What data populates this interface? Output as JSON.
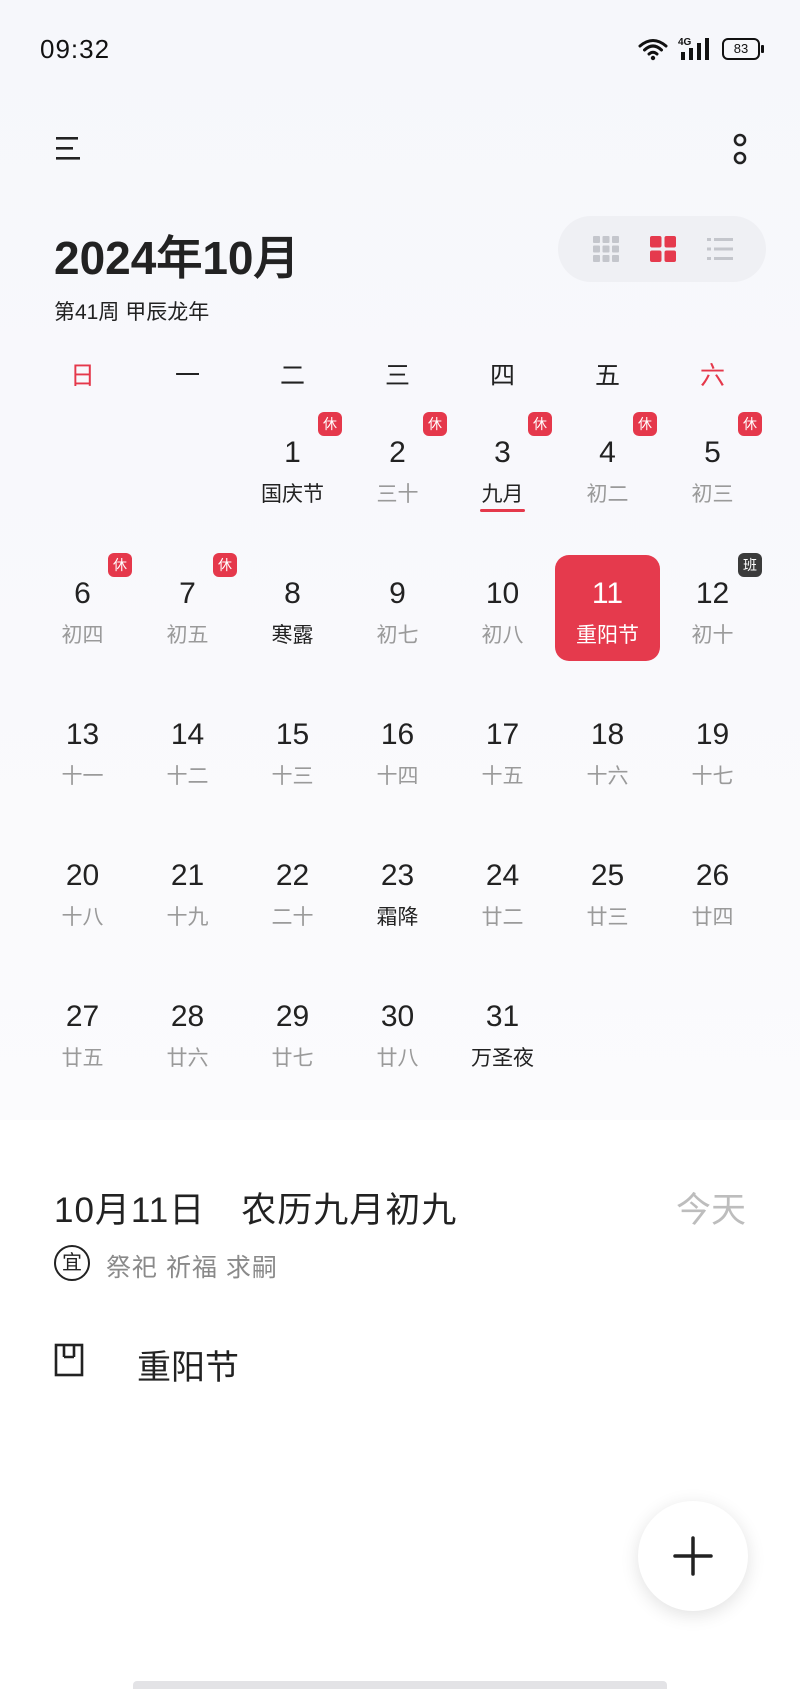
{
  "status": {
    "time": "09:32",
    "network": "4G",
    "battery": "83"
  },
  "header": {
    "title": "2024年10月",
    "subtitle": "第41周 甲辰龙年"
  },
  "view_modes": [
    "month-dense",
    "month-grid",
    "list"
  ],
  "weekdays": [
    "日",
    "一",
    "二",
    "三",
    "四",
    "五",
    "六"
  ],
  "days": [
    {
      "num": "1",
      "sub": "国庆节",
      "badge": "休",
      "strong": true
    },
    {
      "num": "2",
      "sub": "三十",
      "badge": "休"
    },
    {
      "num": "3",
      "sub": "九月",
      "badge": "休",
      "strong": true,
      "underline": true
    },
    {
      "num": "4",
      "sub": "初二",
      "badge": "休"
    },
    {
      "num": "5",
      "sub": "初三",
      "badge": "休"
    },
    {
      "num": "6",
      "sub": "初四",
      "badge": "休"
    },
    {
      "num": "7",
      "sub": "初五",
      "badge": "休"
    },
    {
      "num": "8",
      "sub": "寒露",
      "strong": true
    },
    {
      "num": "9",
      "sub": "初七"
    },
    {
      "num": "10",
      "sub": "初八"
    },
    {
      "num": "11",
      "sub": "重阳节",
      "selected": true
    },
    {
      "num": "12",
      "sub": "初十",
      "badge": "班",
      "badge_dark": true
    },
    {
      "num": "13",
      "sub": "十一"
    },
    {
      "num": "14",
      "sub": "十二"
    },
    {
      "num": "15",
      "sub": "十三"
    },
    {
      "num": "16",
      "sub": "十四"
    },
    {
      "num": "17",
      "sub": "十五"
    },
    {
      "num": "18",
      "sub": "十六"
    },
    {
      "num": "19",
      "sub": "十七"
    },
    {
      "num": "20",
      "sub": "十八"
    },
    {
      "num": "21",
      "sub": "十九"
    },
    {
      "num": "22",
      "sub": "二十"
    },
    {
      "num": "23",
      "sub": "霜降",
      "strong": true
    },
    {
      "num": "24",
      "sub": "廿二"
    },
    {
      "num": "25",
      "sub": "廿三"
    },
    {
      "num": "26",
      "sub": "廿四"
    },
    {
      "num": "27",
      "sub": "廿五"
    },
    {
      "num": "28",
      "sub": "廿六"
    },
    {
      "num": "29",
      "sub": "廿七"
    },
    {
      "num": "30",
      "sub": "廿八"
    },
    {
      "num": "31",
      "sub": "万圣夜",
      "strong": true
    }
  ],
  "detail": {
    "date": "10月11日　农历九月初九",
    "today": "今天",
    "yi_label": "宜",
    "yi_items": "祭祀 祈福 求嗣",
    "holiday": "重阳节"
  },
  "colors": {
    "accent": "#e53a4d",
    "badge_dark": "#3b3b3b",
    "muted": "#9a9a9a"
  }
}
